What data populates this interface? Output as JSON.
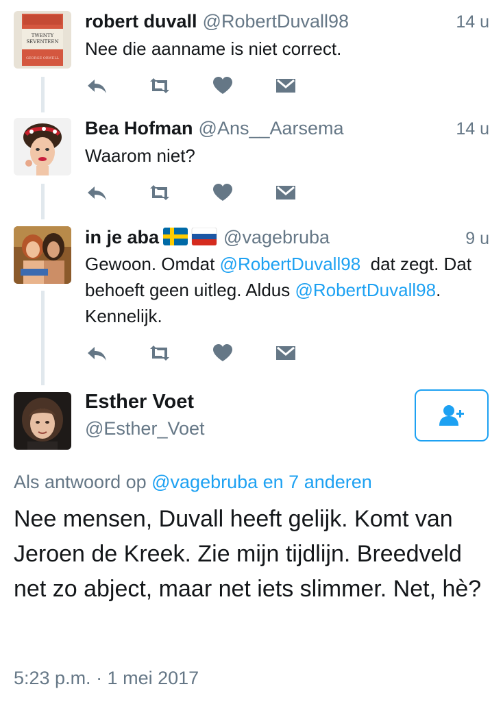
{
  "replies": [
    {
      "name": "robert duvall",
      "handle": "@RobertDuvall98",
      "time": "14 u",
      "text_plain": "Nee die aanname is niet correct."
    },
    {
      "name": "Bea Hofman",
      "handle": "@Ans__Aarsema",
      "time": "14 u",
      "text_plain": "Waarom niet?"
    },
    {
      "name": "in je aba",
      "flags": [
        "sweden-flag-icon",
        "russia-flag-icon"
      ],
      "handle": "@vagebruba",
      "time": "9 u",
      "text_parts": {
        "p1": "Gewoon. Omdat ",
        "link1": "@RobertDuvall98",
        "p2": "  dat zegt. Dat behoeft geen uitleg. Aldus ",
        "link2": "@RobertDuvall98",
        "p3": ". Kennelijk."
      }
    }
  ],
  "main_tweet": {
    "name": "Esther Voet",
    "handle": "@Esther_Voet",
    "reply_prefix": "Als antwoord op ",
    "reply_targets": "@vagebruba en 7 anderen",
    "text": "Nee mensen, Duvall heeft gelijk. Komt van Jeroen de Kreek. Zie mijn tijdlijn. Breedveld net zo abject, maar net iets slimmer. Net, hè?",
    "timestamp": "5:23 p.m. · 1 mei 2017"
  },
  "icons": {
    "reply": "reply-icon",
    "retweet": "retweet-icon",
    "like": "heart-icon",
    "dm": "envelope-icon",
    "follow": "follow-user-icon"
  },
  "colors": {
    "link": "#1da1f2",
    "secondary_text": "#657786",
    "icon_gray": "#657786",
    "thread_line": "#e1e8ed"
  }
}
